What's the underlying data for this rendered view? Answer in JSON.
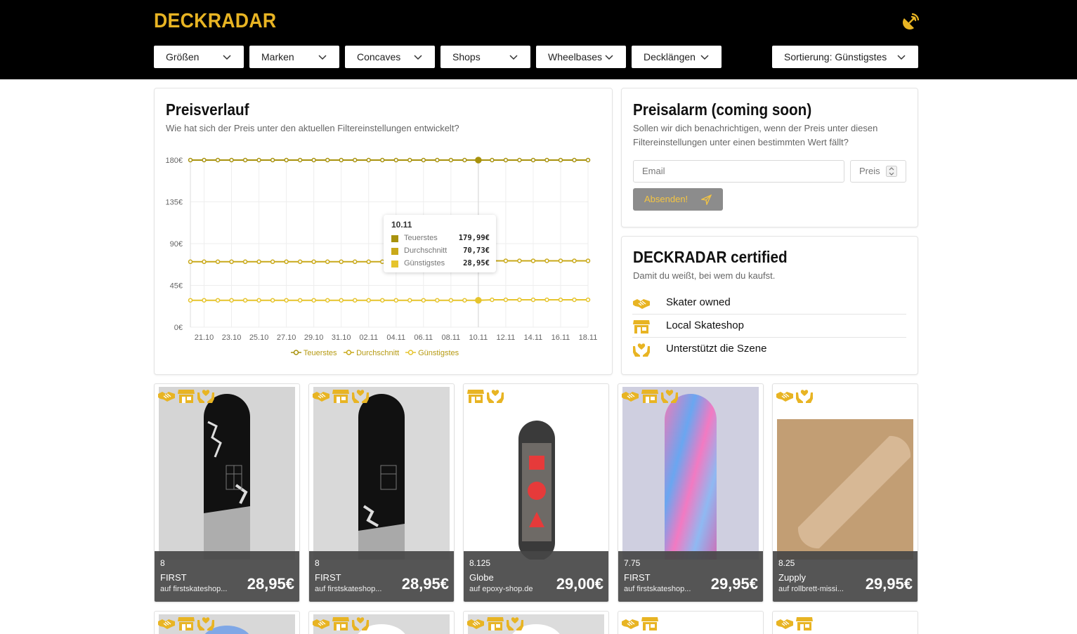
{
  "brand": {
    "name": "DECKRADAR",
    "accent": "#e8b423"
  },
  "header": {
    "filters": [
      {
        "label": "Größen"
      },
      {
        "label": "Marken"
      },
      {
        "label": "Concaves"
      },
      {
        "label": "Shops"
      },
      {
        "label": "Wheelbases"
      },
      {
        "label": "Decklängen"
      }
    ],
    "sort": {
      "label": "Sortierung: Günstigstes"
    },
    "icon": "satellite-dish-icon"
  },
  "preisverlauf": {
    "title": "Preisverlauf",
    "subtitle": "Wie hat sich der Preis unter den aktuellen Filtereinstellungen entwickelt?",
    "tooltip": {
      "date": "10.11",
      "rows": [
        {
          "name": "Teuerstes",
          "value": "179,99€",
          "color": "#a8920d"
        },
        {
          "name": "Durchschnitt",
          "value": "70,73€",
          "color": "#c9a91a"
        },
        {
          "name": "Günstigstes",
          "value": "28,95€",
          "color": "#e6c42c"
        }
      ]
    },
    "legend": [
      "Teuerstes",
      "Durchschnitt",
      "Günstigstes"
    ]
  },
  "chart_data": {
    "type": "line",
    "title": "Preisverlauf",
    "x": [
      "20.10",
      "21.10",
      "22.10",
      "23.10",
      "24.10",
      "25.10",
      "26.10",
      "27.10",
      "28.10",
      "29.10",
      "30.10",
      "31.10",
      "01.11",
      "02.11",
      "03.11",
      "04.11",
      "05.11",
      "06.11",
      "07.11",
      "08.11",
      "09.11",
      "10.11",
      "11.11",
      "12.11",
      "13.11",
      "14.11",
      "15.11",
      "16.11",
      "17.11",
      "18.11"
    ],
    "tick_labels": [
      "21.10",
      "23.10",
      "25.10",
      "27.10",
      "29.10",
      "31.10",
      "02.11",
      "04.11",
      "06.11",
      "08.11",
      "10.11",
      "12.11",
      "14.11",
      "16.11",
      "18.11"
    ],
    "y_ticks": [
      "0€",
      "45€",
      "90€",
      "135€",
      "180€"
    ],
    "ylim": [
      0,
      180
    ],
    "grid": true,
    "legend_position": "bottom",
    "series": [
      {
        "name": "Teuerstes",
        "color": "#a8920d",
        "values": [
          179.99,
          179.99,
          179.99,
          179.99,
          179.99,
          179.99,
          179.99,
          179.99,
          179.99,
          179.99,
          179.99,
          179.99,
          179.99,
          179.99,
          179.99,
          179.99,
          179.99,
          179.99,
          179.99,
          179.99,
          179.99,
          179.99,
          179.99,
          179.99,
          179.99,
          179.99,
          179.99,
          179.99,
          179.99,
          179.99
        ]
      },
      {
        "name": "Durchschnitt",
        "color": "#c9a91a",
        "values": [
          70.5,
          70.5,
          70.5,
          70.5,
          70.5,
          70.5,
          70.5,
          70.5,
          70.5,
          70.5,
          70.5,
          70.5,
          70.5,
          70.5,
          70.5,
          70.6,
          70.6,
          70.6,
          70.6,
          70.7,
          70.7,
          70.73,
          71.5,
          71.5,
          71.5,
          71.5,
          71.5,
          71.5,
          71.5,
          71.5
        ]
      },
      {
        "name": "Günstigstes",
        "color": "#e6c42c",
        "values": [
          28.95,
          28.95,
          28.95,
          28.95,
          28.95,
          28.95,
          28.95,
          28.95,
          28.95,
          28.95,
          28.95,
          28.95,
          28.95,
          28.95,
          28.95,
          28.95,
          28.95,
          28.95,
          28.95,
          28.95,
          28.95,
          28.95,
          29.5,
          29.5,
          29.5,
          29.5,
          29.5,
          29.5,
          29.5,
          29.5
        ]
      }
    ]
  },
  "preisalarm": {
    "title": "Preisalarm (coming soon)",
    "subtitle": "Sollen wir dich benachrichtigen, wenn der Preis unter diesen Filtereinstellungen unter einen bestimmten Wert fällt?",
    "email_placeholder": "Email",
    "price_placeholder": "Preis",
    "submit_label": "Absenden!"
  },
  "certified": {
    "title": "DECKRADAR certified",
    "subtitle": "Damit du weißt, bei wem du kaufst.",
    "items": [
      {
        "label": "Skater owned",
        "icon": "handshake-icon"
      },
      {
        "label": "Local Skateshop",
        "icon": "shop-icon"
      },
      {
        "label": "Unterstützt die Szene",
        "icon": "hands-heart-icon"
      }
    ]
  },
  "products": [
    {
      "size": "8",
      "brand": "FIRST",
      "shop": "auf firstskateshop...",
      "price": "28,95€",
      "badges": [
        "handshake-icon",
        "shop-icon",
        "hands-heart-icon"
      ]
    },
    {
      "size": "8",
      "brand": "FIRST",
      "shop": "auf firstskateshop...",
      "price": "28,95€",
      "badges": [
        "handshake-icon",
        "shop-icon",
        "hands-heart-icon"
      ]
    },
    {
      "size": "8.125",
      "brand": "Globe",
      "shop": "auf epoxy-shop.de",
      "price": "29,00€",
      "badges": [
        "shop-icon",
        "hands-heart-icon"
      ]
    },
    {
      "size": "7.75",
      "brand": "FIRST",
      "shop": "auf firstskateshop...",
      "price": "29,95€",
      "badges": [
        "handshake-icon",
        "shop-icon",
        "hands-heart-icon"
      ]
    },
    {
      "size": "8.25",
      "brand": "Zupply",
      "shop": "auf rollbrett-missi...",
      "price": "29,95€",
      "badges": [
        "handshake-icon",
        "hands-heart-icon"
      ]
    }
  ],
  "products_row2": [
    {
      "badges": [
        "handshake-icon",
        "shop-icon",
        "hands-heart-icon"
      ]
    },
    {
      "badges": [
        "handshake-icon",
        "shop-icon",
        "hands-heart-icon"
      ]
    },
    {
      "badges": [
        "handshake-icon",
        "shop-icon",
        "hands-heart-icon"
      ]
    },
    {
      "badges": [
        "handshake-icon",
        "shop-icon"
      ]
    },
    {
      "badges": [
        "handshake-icon",
        "shop-icon"
      ]
    }
  ]
}
